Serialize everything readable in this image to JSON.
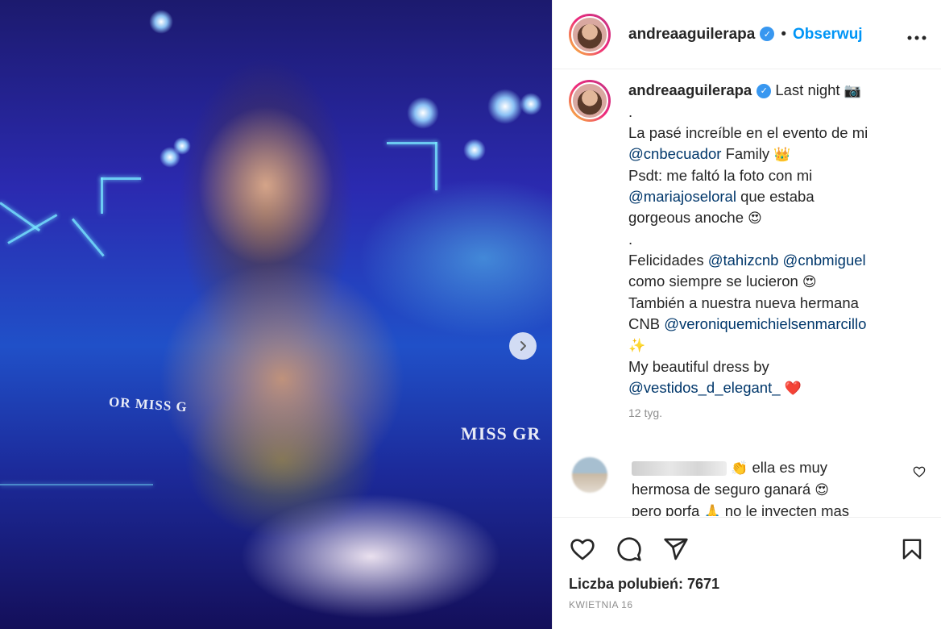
{
  "post": {
    "username": "andreaaguilerapa",
    "follow_label": "Obserwuj",
    "separator": "•",
    "more_label": "•••"
  },
  "caption": {
    "username": "andreaaguilerapa",
    "title": "Last night",
    "title_emoji": "📷",
    "line_dot1": ".",
    "line1": "La pasé increíble en el evento de mi",
    "mention1": "@cnbecuador",
    "line2_rest": "Family",
    "line2_emoji": "👑",
    "line3": "Psdt: me faltó la foto con mi",
    "mention2": "@mariajoseloral",
    "line4_rest": "que estaba",
    "line5": "gorgeous anoche",
    "line5_emoji": "😍",
    "line_dot2": ".",
    "line6": "Felicidades",
    "mention3": "@tahizcnb",
    "mention4": "@cnbmiguel",
    "line7": "como siempre se lucieron",
    "line7_emoji": "😍",
    "line8": "También a nuestra nueva hermana",
    "line9": "CNB",
    "mention5": "@veroniquemichielsenmarcillo",
    "line10_emoji": "✨",
    "line11": "My beautiful dress by",
    "mention6": "@vestidos_d_elegant_",
    "line12_emoji": "❤️",
    "time": "12 tyg."
  },
  "comment": {
    "emoji1": "👏",
    "text1": "ella es muy",
    "text2": "hermosa de seguro ganará",
    "emoji2": "😍",
    "text3": "pero porfa",
    "emoji3": "🙏",
    "text4": "no le inyecten mas"
  },
  "photo": {
    "stage_text1": "OR MISS G",
    "stage_text2": "MISS GR"
  },
  "footer": {
    "likes": "Liczba polubień: 7671",
    "date": "KWIETNIA 16"
  },
  "icons": {
    "like": "heart-icon",
    "comment": "comment-icon",
    "share": "share-icon",
    "save": "bookmark-icon",
    "next": "chevron-right-icon",
    "verified": "verified-badge-icon"
  },
  "colors": {
    "link": "#0095f6",
    "mention": "#00376b",
    "verified": "#3897f0",
    "muted": "#8e8e8e"
  }
}
